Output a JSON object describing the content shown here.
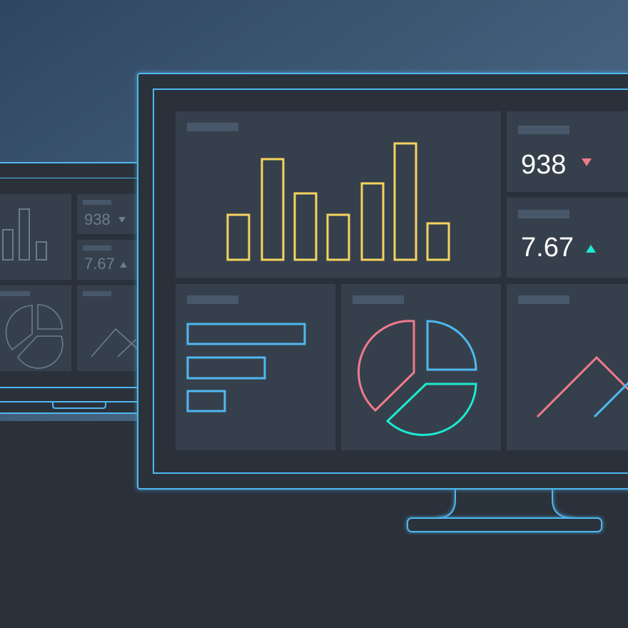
{
  "colors": {
    "sky_top": "#3a5878",
    "floor": "#2b313b",
    "monitor_outline": "#4fb8f0",
    "screen_bg": "#2b313b",
    "panel_bg": "#36404c",
    "placeholder_bar": "#48586a",
    "bar_chart_yellow": "#f4d35e",
    "bar_chart_blue": "#4fb8f0",
    "pie_pink": "#ef7a8c",
    "pie_blue": "#4fb8f0",
    "pie_teal": "#1de9d2",
    "line_pink": "#ef7a8c",
    "line_blue": "#4fb8f0",
    "down_arrow": "#ef7a8c",
    "up_arrow": "#1de9d2"
  },
  "dashboard": {
    "metric_1": {
      "value": "938",
      "trend": "down"
    },
    "metric_2": {
      "value": "7.67",
      "trend": "up"
    }
  },
  "background_laptop": {
    "metric_1": {
      "value": "938",
      "trend": "down"
    },
    "metric_2": {
      "value": "7.67",
      "trend": "up"
    }
  },
  "charts": {
    "column_chart_relative_values": [
      0.43,
      1.0,
      0.65,
      0.43,
      0.75,
      1.12,
      0.35
    ],
    "bar_chart_relative_values": [
      1.0,
      0.66,
      0.31
    ],
    "icons": [
      "column-chart-icon",
      "bar-chart-icon",
      "pie-chart-icon",
      "line-chart-icon"
    ]
  }
}
